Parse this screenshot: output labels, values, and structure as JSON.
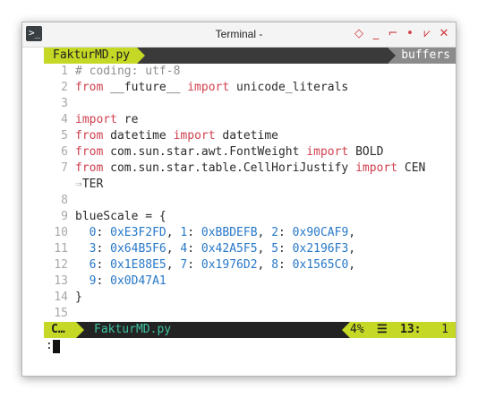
{
  "window": {
    "title": "Terminal -",
    "app_icon": "terminal-icon",
    "app_icon_glyph": ">_",
    "controls": [
      {
        "name": "pin-icon",
        "glyph": "◇"
      },
      {
        "name": "minimize-icon",
        "glyph": "_"
      },
      {
        "name": "maximize-icon",
        "glyph": "⌐"
      },
      {
        "name": "dot-menu-icon",
        "glyph": "•"
      },
      {
        "name": "shade-icon",
        "glyph": "⩗"
      },
      {
        "name": "close-icon",
        "glyph": "✕"
      }
    ],
    "accent_color": "#c4d825"
  },
  "tabline": {
    "active_tab": "FakturMD.py",
    "right_label": "buffers"
  },
  "editor": {
    "lines": [
      {
        "n": "1",
        "tokens": [
          {
            "t": "# coding: utf-8",
            "c": "cm"
          }
        ]
      },
      {
        "n": "2",
        "tokens": [
          {
            "t": "from",
            "c": "kw"
          },
          {
            "t": " __future__ "
          },
          {
            "t": "import",
            "c": "kw"
          },
          {
            "t": " unicode_literals"
          }
        ]
      },
      {
        "n": "3",
        "tokens": []
      },
      {
        "n": "4",
        "tokens": [
          {
            "t": "import",
            "c": "kw"
          },
          {
            "t": " re"
          }
        ]
      },
      {
        "n": "5",
        "tokens": [
          {
            "t": "from",
            "c": "kw"
          },
          {
            "t": " datetime "
          },
          {
            "t": "import",
            "c": "kw"
          },
          {
            "t": " datetime"
          }
        ]
      },
      {
        "n": "6",
        "tokens": [
          {
            "t": "from",
            "c": "kw"
          },
          {
            "t": " com.sun.star.awt.FontWeight "
          },
          {
            "t": "import",
            "c": "kw"
          },
          {
            "t": " BOLD"
          }
        ]
      },
      {
        "n": "7",
        "tokens": [
          {
            "t": "from",
            "c": "kw"
          },
          {
            "t": " com.sun.star.table.CellHoriJustify "
          },
          {
            "t": "import",
            "c": "kw"
          },
          {
            "t": " CEN"
          }
        ]
      },
      {
        "n": "",
        "tokens": [
          {
            "t": "⇒",
            "c": "wrapmark"
          },
          {
            "t": "TER"
          }
        ]
      },
      {
        "n": "8",
        "tokens": []
      },
      {
        "n": "9",
        "tokens": [
          {
            "t": "blueScale = {"
          }
        ]
      },
      {
        "n": "10",
        "tokens": [
          {
            "t": "  "
          },
          {
            "t": "0",
            "c": "num"
          },
          {
            "t": ": "
          },
          {
            "t": "0xE3F2FD",
            "c": "num"
          },
          {
            "t": ", "
          },
          {
            "t": "1",
            "c": "num"
          },
          {
            "t": ": "
          },
          {
            "t": "0xBBDEFB",
            "c": "num"
          },
          {
            "t": ", "
          },
          {
            "t": "2",
            "c": "num"
          },
          {
            "t": ": "
          },
          {
            "t": "0x90CAF9",
            "c": "num"
          },
          {
            "t": ","
          }
        ]
      },
      {
        "n": "11",
        "tokens": [
          {
            "t": "  "
          },
          {
            "t": "3",
            "c": "num"
          },
          {
            "t": ": "
          },
          {
            "t": "0x64B5F6",
            "c": "num"
          },
          {
            "t": ", "
          },
          {
            "t": "4",
            "c": "num"
          },
          {
            "t": ": "
          },
          {
            "t": "0x42A5F5",
            "c": "num"
          },
          {
            "t": ", "
          },
          {
            "t": "5",
            "c": "num"
          },
          {
            "t": ": "
          },
          {
            "t": "0x2196F3",
            "c": "num"
          },
          {
            "t": ","
          }
        ]
      },
      {
        "n": "12",
        "tokens": [
          {
            "t": "  "
          },
          {
            "t": "6",
            "c": "num"
          },
          {
            "t": ": "
          },
          {
            "t": "0x1E88E5",
            "c": "num"
          },
          {
            "t": ", "
          },
          {
            "t": "7",
            "c": "num"
          },
          {
            "t": ": "
          },
          {
            "t": "0x1976D2",
            "c": "num"
          },
          {
            "t": ", "
          },
          {
            "t": "8",
            "c": "num"
          },
          {
            "t": ": "
          },
          {
            "t": "0x1565C0",
            "c": "num"
          },
          {
            "t": ","
          }
        ]
      },
      {
        "n": "13",
        "tokens": [
          {
            "t": "  "
          },
          {
            "t": "9",
            "c": "num"
          },
          {
            "t": ": "
          },
          {
            "t": "0x0D47A1",
            "c": "num"
          }
        ]
      },
      {
        "n": "14",
        "tokens": [
          {
            "t": "}"
          }
        ]
      },
      {
        "n": "15",
        "tokens": []
      }
    ]
  },
  "statusline": {
    "mode": "C…",
    "filename": "FakturMD.py",
    "percent": "4%",
    "menu_glyph": "☰",
    "line": "13:",
    "column": "1"
  },
  "cmdline": {
    "prompt": ":"
  }
}
